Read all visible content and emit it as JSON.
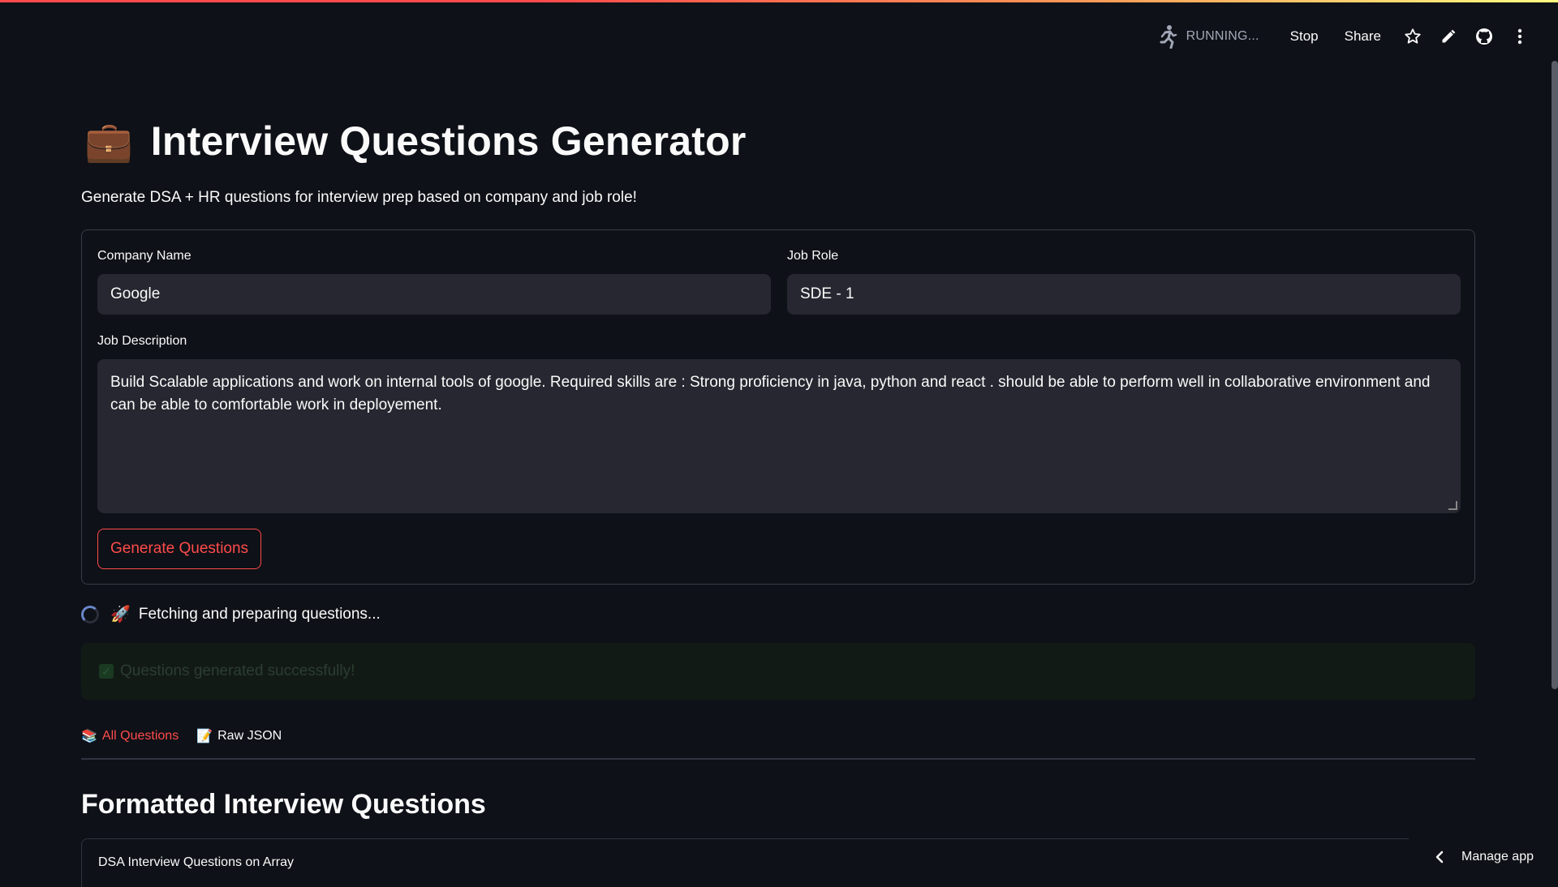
{
  "toolbar": {
    "status": "RUNNING...",
    "stop_label": "Stop",
    "share_label": "Share",
    "icons": [
      "running-man-icon",
      "star-icon",
      "edit-icon",
      "github-icon",
      "more-vertical-icon"
    ]
  },
  "page": {
    "title_icon": "💼",
    "title": "Interview Questions Generator",
    "subtitle": "Generate DSA + HR questions for interview prep based on company and job role!"
  },
  "form": {
    "company_label": "Company Name",
    "company_value": "Google",
    "role_label": "Job Role",
    "role_value": "SDE - 1",
    "description_label": "Job Description",
    "description_value": "Build Scalable applications and work on internal tools of google. Required skills are : Strong proficiency in java, python and react . should be able to perform well in collaborative environment and can be able to comfortable work in deployement.",
    "submit_label": "Generate Questions"
  },
  "progress": {
    "icon": "🚀",
    "message": "Fetching and preparing questions..."
  },
  "success": {
    "message": "Questions generated successfully!"
  },
  "tabs": [
    {
      "icon": "📚",
      "label": "All Questions",
      "active": true
    },
    {
      "icon": "📝",
      "label": "Raw JSON",
      "active": false
    }
  ],
  "results": {
    "heading": "Formatted Interview Questions",
    "first_expander": "DSA Interview Questions on Array"
  },
  "footer": {
    "manage_label": "Manage app"
  },
  "colors": {
    "background": "#0e1117",
    "accent": "#ff4b4b",
    "input_bg": "#262730"
  }
}
